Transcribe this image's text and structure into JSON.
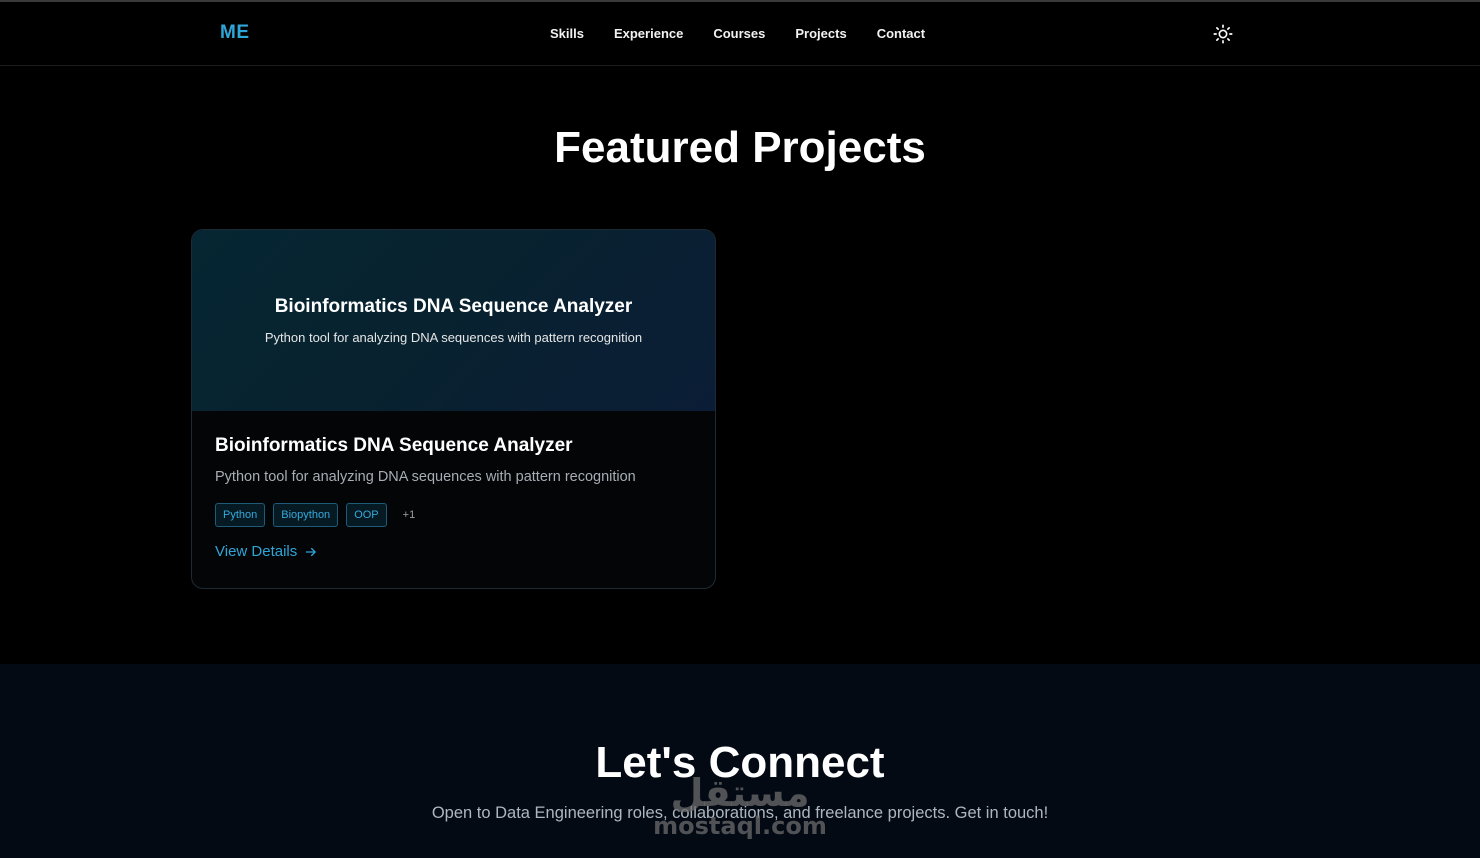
{
  "nav": {
    "logo": "ME",
    "links": [
      "Skills",
      "Experience",
      "Courses",
      "Projects",
      "Contact"
    ],
    "theme_toggle_icon": "sun-icon"
  },
  "featured": {
    "title": "Featured Projects",
    "project": {
      "banner_title": "Bioinformatics DNA Sequence Analyzer",
      "banner_desc": "Python tool for analyzing DNA sequences with pattern recognition",
      "title": "Bioinformatics DNA Sequence Analyzer",
      "desc": "Python tool for analyzing DNA sequences with pattern recognition",
      "tags": [
        "Python",
        "Biopython",
        "OOP"
      ],
      "more_tags": "+1",
      "link_label": "View Details",
      "link_icon": "arrow-right-icon"
    }
  },
  "connect": {
    "title": "Let's Connect",
    "subtitle": "Open to Data Engineering roles, collaborations, and freelance projects. Get in touch!"
  },
  "watermark": {
    "arabic": "مستقل",
    "latin": "mostaql.com"
  },
  "colors": {
    "accent": "#2ea6d8",
    "background": "#000000",
    "connect_bg": "#040a14"
  }
}
